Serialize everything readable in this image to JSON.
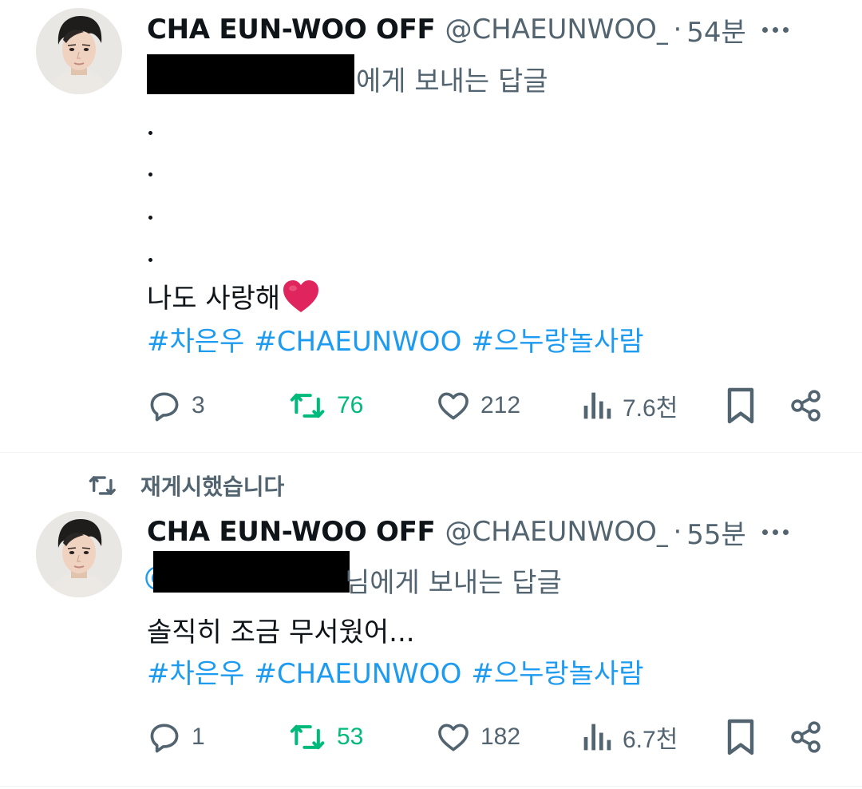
{
  "colors": {
    "text": "#0f1419",
    "muted": "#536471",
    "link": "#1d9bf0",
    "retweet_green": "#00ba7c",
    "heart_red": "#e0245e",
    "redaction": "#000000"
  },
  "tweets": [
    {
      "author_name": "CHA EUN-WOO OFF",
      "handle": "@CHAEUNWOO_OFFICIAL",
      "separator": "·",
      "time": "54분",
      "reply_to_suffix": "에게 보내는 답글",
      "body_lines": [
        ".",
        ".",
        ".",
        ".",
        "나도 사랑해"
      ],
      "heart_emoji": "heart-icon",
      "hashtags": [
        "#차은우",
        "#CHAEUNWOO",
        "#으누랑놀사람"
      ],
      "stats": {
        "replies": "3",
        "retweets": "76",
        "likes": "212",
        "views": "7.6천"
      }
    },
    {
      "retweet_header": "재게시했습니다",
      "author_name": "CHA EUN-WOO OFF",
      "handle": "@CHAEUNWOO_OFFICIAL",
      "separator": "·",
      "time": "55분",
      "reply_prefix_visible": "@",
      "reply_to_suffix": "님에게 보내는 답글",
      "body": "솔직히 조금 무서웠어...",
      "hashtags": [
        "#차은우",
        "#CHAEUNWOO",
        "#으누랑놀사람"
      ],
      "stats": {
        "replies": "1",
        "retweets": "53",
        "likes": "182",
        "views": "6.7천"
      }
    }
  ]
}
